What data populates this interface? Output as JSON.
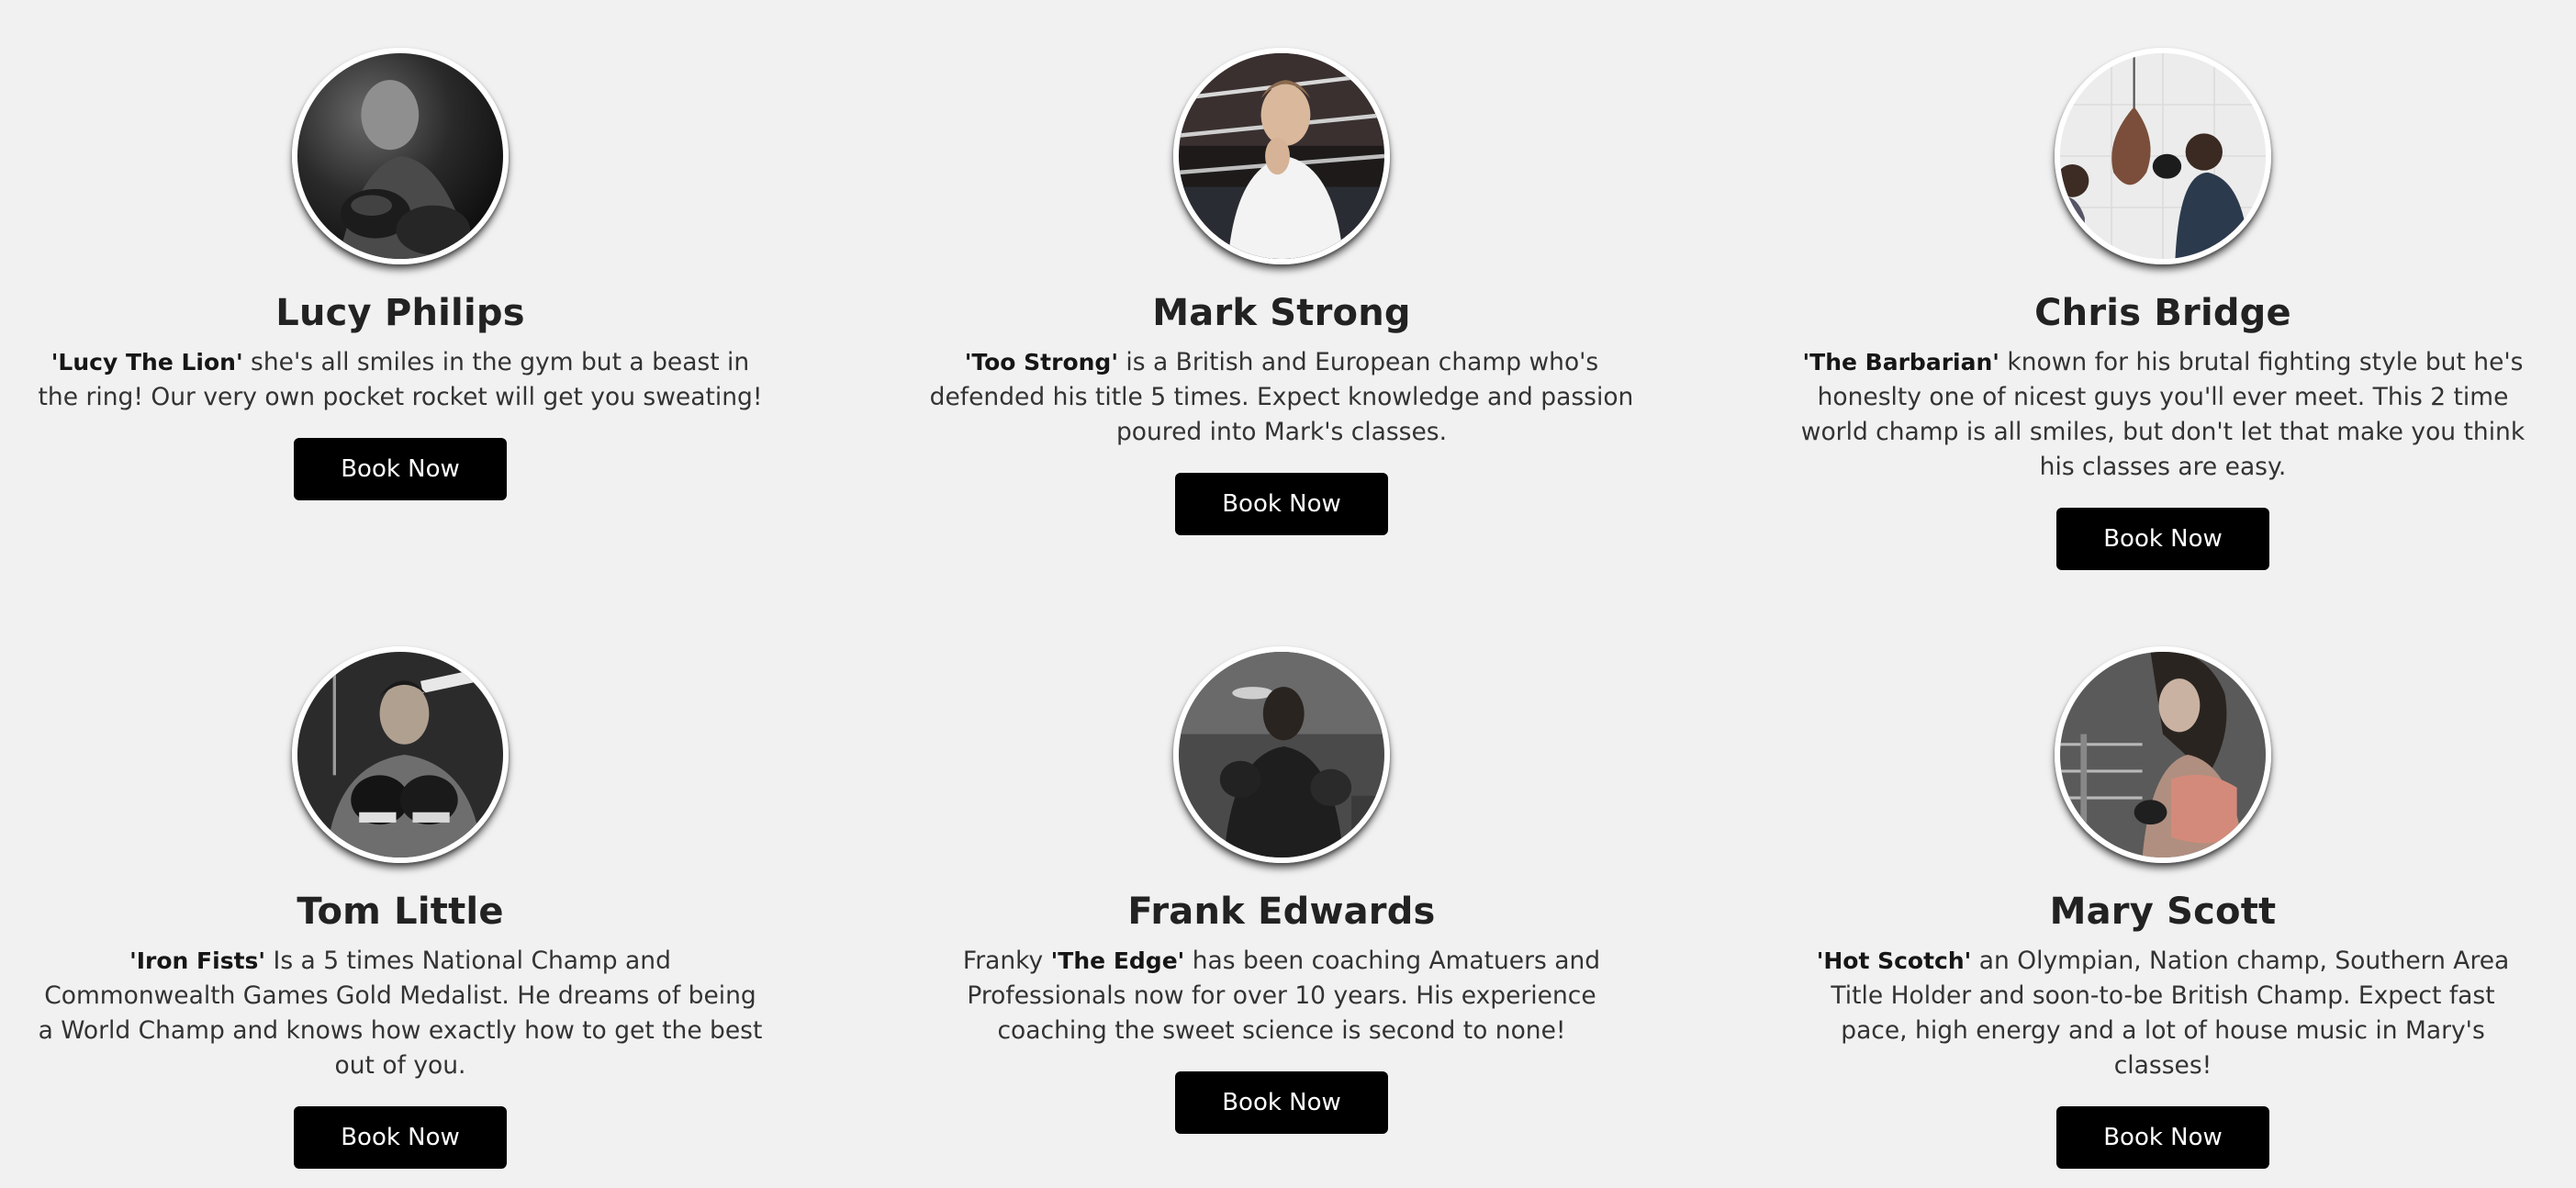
{
  "trainers": [
    {
      "name": "Lucy Philips",
      "nickname": "'Lucy The Lion'",
      "bio_prefix": "",
      "bio": " she's all smiles in the gym but a beast in the ring! Our very own pocket rocket will get you sweating!",
      "button_label": "Book Now"
    },
    {
      "name": "Mark Strong",
      "nickname": "'Too Strong'",
      "bio_prefix": "",
      "bio": " is a British and European champ who's defended his title 5 times. Expect knowledge and passion poured into Mark's classes.",
      "button_label": "Book Now"
    },
    {
      "name": "Chris Bridge",
      "nickname": "'The Barbarian'",
      "bio_prefix": "",
      "bio": " known for his brutal fighting style but he's honeslty one of nicest guys you'll ever meet. This 2 time world champ is all smiles, but don't let that make you think his classes are easy.",
      "button_label": "Book Now"
    },
    {
      "name": "Tom Little",
      "nickname": "'Iron Fists'",
      "bio_prefix": "",
      "bio": " Is a 5 times National Champ and Commonwealth Games Gold Medalist. He dreams of being a World Champ and knows how exactly how to get the best out of you.",
      "button_label": "Book Now"
    },
    {
      "name": "Frank Edwards",
      "nickname": "'The Edge'",
      "bio_prefix": "Franky ",
      "bio": " has been coaching Amatuers and Professionals now for over 10 years. His experience coaching the sweet science is second to none!",
      "button_label": "Book Now"
    },
    {
      "name": "Mary Scott",
      "nickname": "'Hot Scotch'",
      "bio_prefix": "",
      "bio": " an Olympian, Nation champ, Southern Area Title Holder and soon-to-be British Champ. Expect fast pace, high energy and a lot of house music in Mary's classes!",
      "button_label": "Book Now"
    }
  ],
  "colors": {
    "background": "#f1f1f1",
    "button_bg": "#000000",
    "button_text": "#ffffff",
    "heading": "#222222"
  }
}
